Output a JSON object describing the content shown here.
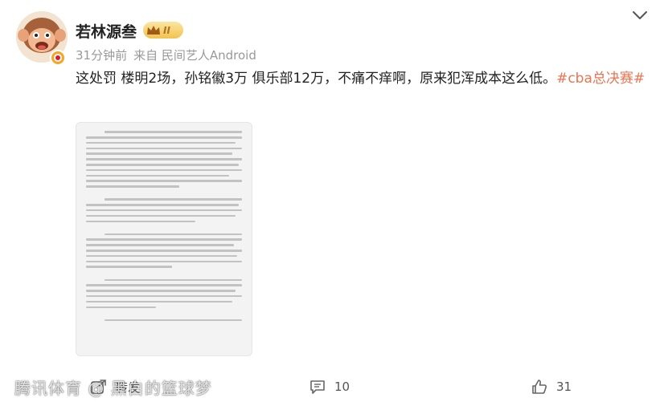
{
  "post": {
    "author_name": "若林源叁",
    "vip_level": "II",
    "time": "31分钟前",
    "source": "来自 民间艺人Android",
    "text": "这处罚 楼明2场，孙铭徽3万 俱乐部12万，不痛不痒啊，原来犯浑成本这么低。",
    "hashtag": "#cba总决赛#"
  },
  "actions": {
    "share_label": "转发",
    "comment_count": "10",
    "like_count": "31"
  },
  "watermark": "腾讯体育 @ 黑白的篮球梦",
  "icons": {
    "avatar": "monkey-avatar",
    "badge": "weibo-verified-badge",
    "vip": "crown-icon",
    "menu": "chevron-down-icon",
    "share": "share-icon",
    "comment": "comment-icon",
    "like": "like-icon"
  },
  "colors": {
    "hashtag": "#eb7350",
    "meta": "#999999",
    "vip_badge": "#f2c24e"
  }
}
